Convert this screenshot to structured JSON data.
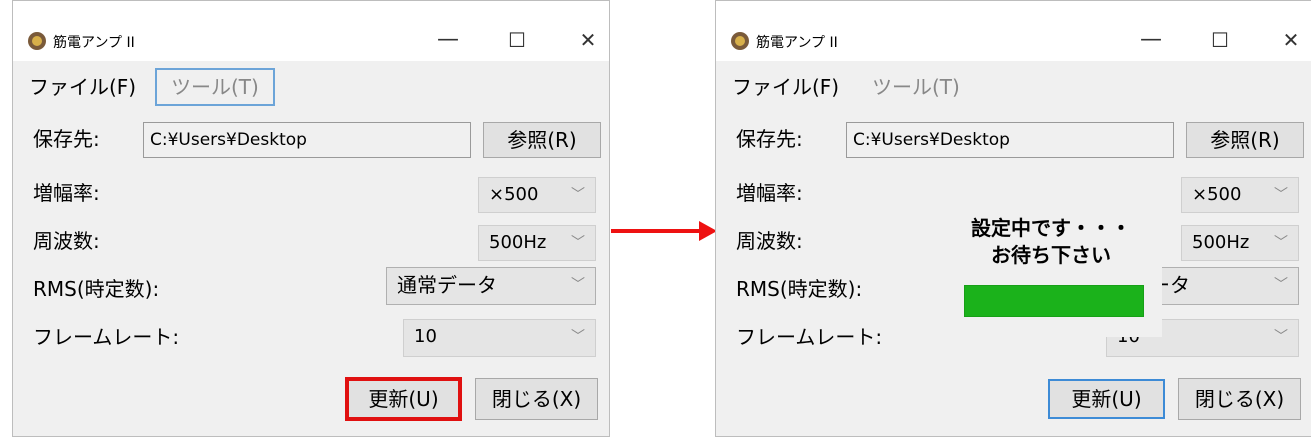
{
  "windows": [
    {
      "title": "筋電アンプ II",
      "menu": {
        "file": "ファイル(F)",
        "tool": "ツール(T)"
      },
      "save_label": "保存先:",
      "save_path": "C:¥Users¥Desktop",
      "browse_button": "参照(R)",
      "gain_label": "増幅率:",
      "gain_value": "×500",
      "freq_label": "周波数:",
      "freq_value": "500Hz",
      "rms_label": "RMS(時定数):",
      "rms_value": "通常データ",
      "frame_label": "フレームレート:",
      "frame_value": "10",
      "update_button": "更新(U)",
      "close_button": "閉じる(X)"
    },
    {
      "title": "筋電アンプ II",
      "menu": {
        "file": "ファイル(F)",
        "tool": "ツール(T)"
      },
      "save_label": "保存先:",
      "save_path": "C:¥Users¥Desktop",
      "browse_button": "参照(R)",
      "gain_label": "増幅率:",
      "gain_value": "×500",
      "freq_label": "周波数:",
      "freq_value": "500Hz",
      "rms_label": "RMS(時定数):",
      "rms_value": "ータ",
      "frame_label": "フレームレート:",
      "frame_value": "10",
      "update_button": "更新(U)",
      "close_button": "閉じる(X)",
      "overlay": {
        "line1": "設定中です・・・",
        "line2": "お待ち下さい"
      }
    }
  ],
  "window_controls": {
    "minimize": "—",
    "maximize": "☐",
    "close": "✕"
  },
  "colors": {
    "highlight_red": "#e01010",
    "arrow": "#ee1111",
    "progress": "#1bb21b",
    "focus_blue": "#3d8bd6"
  }
}
